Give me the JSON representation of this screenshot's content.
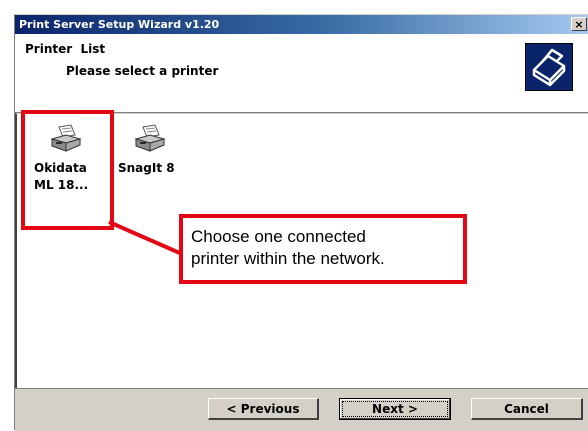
{
  "window": {
    "title": "Print Server Setup Wizard v1.20",
    "close_glyph": "×"
  },
  "header": {
    "title": "Printer  List",
    "subtitle": "Please select a printer",
    "icon": "printer-emblem-icon"
  },
  "printers": [
    {
      "name_line1": "Okidata",
      "name_line2": "ML 18...",
      "icon": "printer-icon",
      "highlighted": true
    },
    {
      "name_line1": "SnagIt 8",
      "name_line2": "",
      "icon": "printer-icon",
      "highlighted": false
    }
  ],
  "callout": {
    "line1": "Choose one connected",
    "line2": "printer within the network."
  },
  "buttons": {
    "previous": "< Previous",
    "next": "Next >",
    "cancel": "Cancel"
  },
  "colors": {
    "annotation": "#e30613",
    "title_bar": "#0a246a",
    "dialog_face": "#d4d0c8"
  }
}
